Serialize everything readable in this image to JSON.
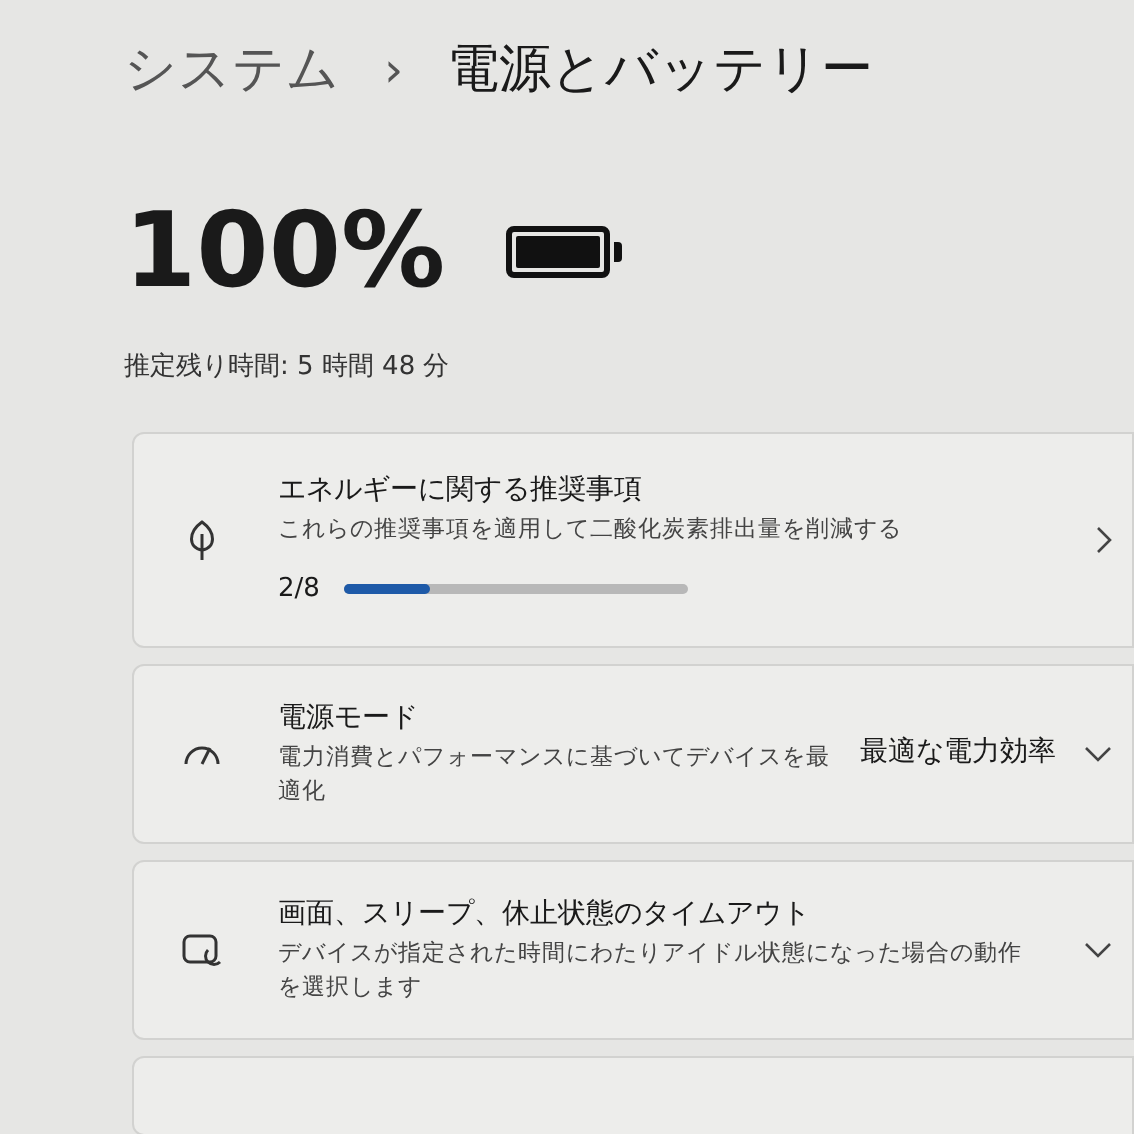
{
  "breadcrumb": {
    "parent": "システム",
    "separator": "›",
    "current": "電源とバッテリー"
  },
  "battery": {
    "percent": "100%",
    "level": 1,
    "remaining": "推定残り時間: 5 時間 48 分"
  },
  "cards": [
    {
      "kind": "progress",
      "title": "エネルギーに関する推奨事項",
      "description": "これらの推奨事項を適用して二酸化炭素排出量を削減する",
      "count": "2/8",
      "level": 0.25
    },
    {
      "kind": "dropdown",
      "title": "電源モード",
      "description": "電力消費とパフォーマンスに基づいてデバイスを最適化",
      "value": "最適な電力効率"
    },
    {
      "kind": "expander",
      "title": "画面、スリープ、休止状態のタイムアウト",
      "description": "デバイスが指定された時間にわたりアイドル状態になった場合の動作を選択します"
    }
  ]
}
